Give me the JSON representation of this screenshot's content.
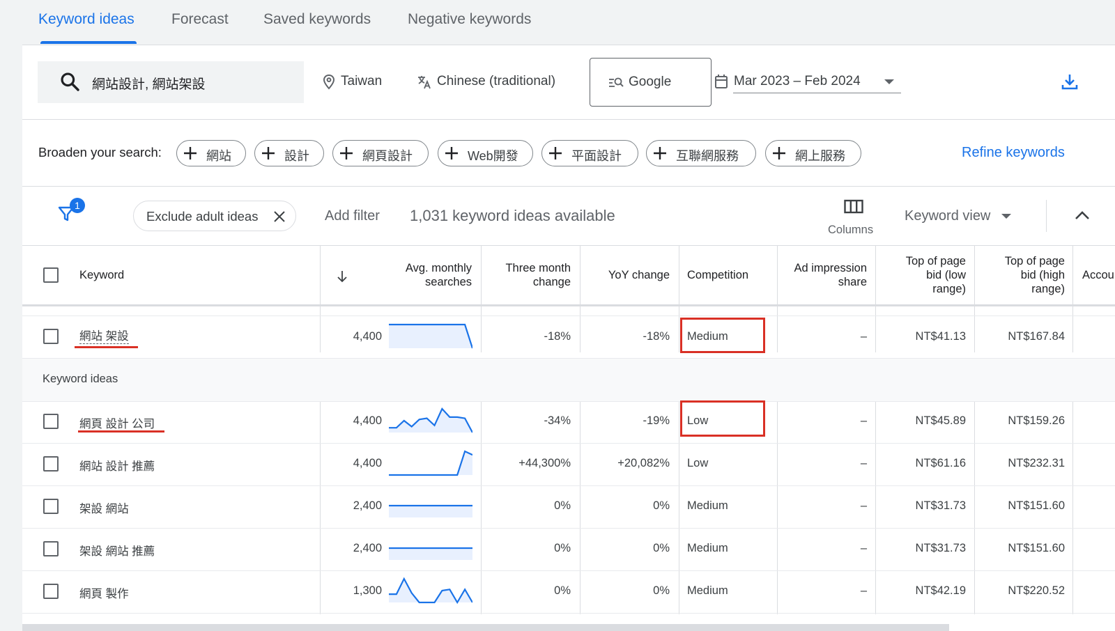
{
  "tabs": [
    {
      "label": "Keyword ideas",
      "active": true
    },
    {
      "label": "Forecast",
      "active": false
    },
    {
      "label": "Saved keywords",
      "active": false
    },
    {
      "label": "Negative keywords",
      "active": false
    }
  ],
  "search": {
    "value": "網站設計, 網站架設"
  },
  "location": "Taiwan",
  "language": "Chinese (traditional)",
  "network": "Google",
  "date_range": "Mar 2023 – Feb 2024",
  "broaden": {
    "label": "Broaden your search:",
    "chips": [
      "網站",
      "設計",
      "網頁設計",
      "Web開發",
      "平面設計",
      "互聯網服務",
      "網上服務"
    ],
    "refine_label": "Refine keywords"
  },
  "filter_bar": {
    "badge": "1",
    "exclude_chip": "Exclude adult ideas",
    "add_filter": "Add filter",
    "count_text": "1,031 keyword ideas available",
    "columns_label": "Columns",
    "view_label": "Keyword view"
  },
  "table": {
    "headers": {
      "keyword": "Keyword",
      "avg_monthly": [
        "Avg. monthly",
        "searches"
      ],
      "three_month": [
        "Three month",
        "change"
      ],
      "yoy": "YoY change",
      "competition": "Competition",
      "impression": [
        "Ad impression",
        "share"
      ],
      "bid_low": [
        "Top of page",
        "bid (low",
        "range)"
      ],
      "bid_high": [
        "Top of page",
        "bid (high",
        "range)"
      ],
      "account": "Accou"
    },
    "provided": [
      {
        "keyword": "網站 架設",
        "searches": "4,400",
        "three_month": "-18%",
        "yoy": "-18%",
        "competition": "Medium",
        "impression": "–",
        "bid_low": "NT$41.13",
        "bid_high": "NT$167.84",
        "trend": [
          1,
          1,
          1,
          1,
          1,
          1,
          1,
          1,
          1,
          1,
          1,
          0
        ]
      }
    ],
    "ideas_label": "Keyword ideas",
    "ideas": [
      {
        "keyword": "網頁 設計 公司",
        "searches": "4,400",
        "three_month": "-34%",
        "yoy": "-19%",
        "competition": "Low",
        "impression": "–",
        "bid_low": "NT$45.89",
        "bid_high": "NT$159.26",
        "trend": [
          0.2,
          0.2,
          0.5,
          0.25,
          0.55,
          0.6,
          0.3,
          1,
          0.65,
          0.65,
          0.6,
          0
        ]
      },
      {
        "keyword": "網站 設計 推薦",
        "searches": "4,400",
        "three_month": "+44,300%",
        "yoy": "+20,082%",
        "competition": "Low",
        "impression": "–",
        "bid_low": "NT$61.16",
        "bid_high": "NT$232.31",
        "trend": [
          0,
          0,
          0,
          0,
          0,
          0,
          0,
          0,
          0,
          0,
          1,
          0.85
        ]
      },
      {
        "keyword": "架設 網站",
        "searches": "2,400",
        "three_month": "0%",
        "yoy": "0%",
        "competition": "Medium",
        "impression": "–",
        "bid_low": "NT$31.73",
        "bid_high": "NT$151.60",
        "trend": [
          0.5,
          0.5,
          0.5,
          0.5,
          0.5,
          0.5,
          0.5,
          0.5,
          0.5,
          0.5,
          0.5,
          0.5
        ]
      },
      {
        "keyword": "架設 網站 推薦",
        "searches": "2,400",
        "three_month": "0%",
        "yoy": "0%",
        "competition": "Medium",
        "impression": "–",
        "bid_low": "NT$31.73",
        "bid_high": "NT$151.60",
        "trend": [
          0.5,
          0.5,
          0.5,
          0.5,
          0.5,
          0.5,
          0.5,
          0.5,
          0.5,
          0.5,
          0.5,
          0.5
        ]
      },
      {
        "keyword": "網頁 製作",
        "searches": "1,300",
        "three_month": "0%",
        "yoy": "0%",
        "competition": "Medium",
        "impression": "–",
        "bid_low": "NT$42.19",
        "bid_high": "NT$220.52",
        "trend": [
          0.35,
          0.35,
          1,
          0.4,
          0,
          0,
          0,
          0.5,
          0.55,
          0,
          0.55,
          0
        ]
      }
    ]
  },
  "colors": {
    "accent": "#1a73e8",
    "annotation_red": "#d93025",
    "spark_fill": "#e8f0fe"
  }
}
